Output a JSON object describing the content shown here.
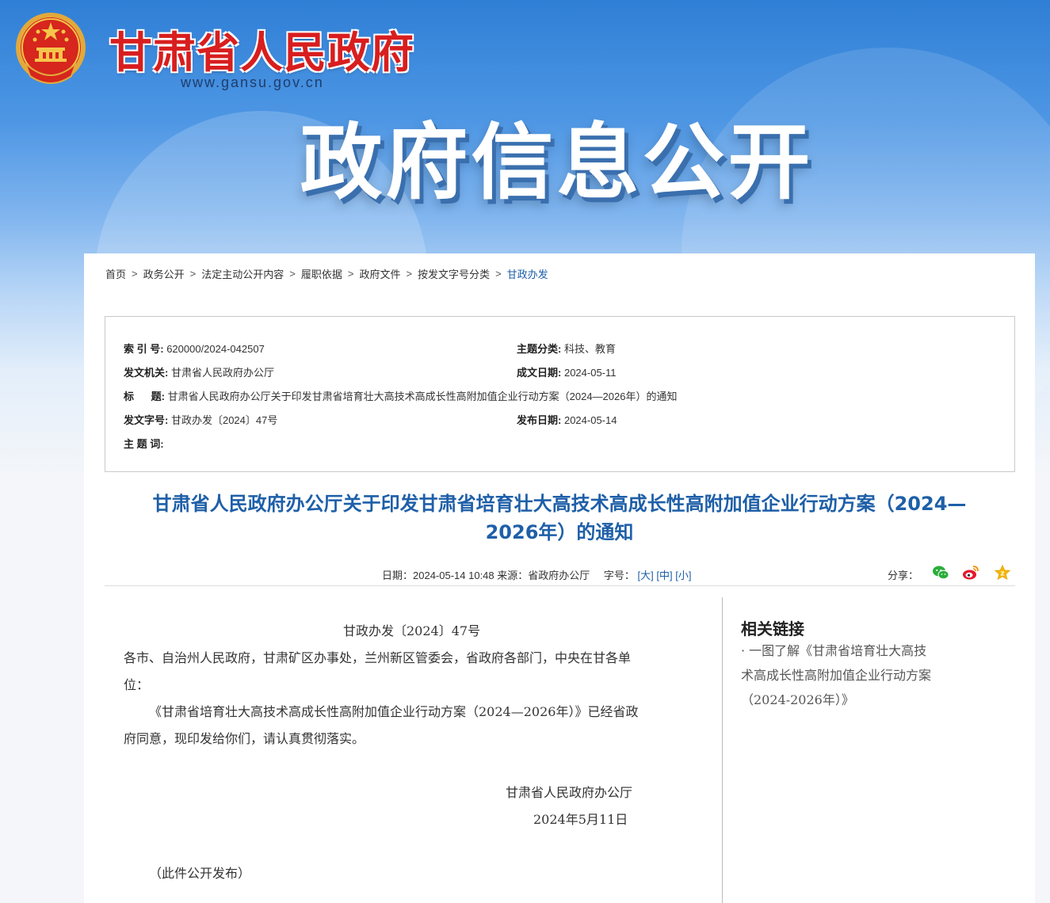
{
  "header": {
    "site_title": "甘肃省人民政府",
    "site_url": "www.gansu.gov.cn",
    "banner_heading": "政府信息公开"
  },
  "breadcrumb": [
    "首页",
    "政务公开",
    "法定主动公开内容",
    "履职依据",
    "政府文件",
    "按发文字号分类",
    "甘政办发"
  ],
  "breadcrumb_sep": ">",
  "meta": {
    "index_no_label": "索 引 号:",
    "index_no": "620000/2024-042507",
    "topic_label": "主题分类:",
    "topic": "科技、教育",
    "issuer_label": "发文机关:",
    "issuer": "甘肃省人民政府办公厅",
    "created_label": "成文日期:",
    "created": "2024-05-11",
    "title_label": "标      题:",
    "title": "甘肃省人民政府办公厅关于印发甘肃省培育壮大高技术高成长性高附加值企业行动方案（2024—2026年）的通知",
    "doc_no_label": "发文字号:",
    "doc_no": "甘政办发〔2024〕47号",
    "published_label": "发布日期:",
    "published": "2024-05-14",
    "keywords_label": "主 题 词:"
  },
  "doc_title_line1": "甘肃省人民政府办公厅关于印发甘肃省培育壮大高技术高成长性高附加值企业行动方案（2024—",
  "doc_title_line2": "2026年）的通知",
  "info_bar": {
    "date_text": "日期：2024-05-14 10:48 来源：省政府办公厅",
    "font_label": "字号：",
    "font_large": "[大]",
    "font_medium": "[中]",
    "font_small": "[小]",
    "share_label": "分享："
  },
  "body": {
    "doc_no": "甘政办发〔2024〕47号",
    "recipients_line1": "各市、自治州人民政府，甘肃矿区办事处，兰州新区管委会，省政府各部门，中央在甘各单",
    "recipients_line2": "位：",
    "para_line1": "《甘肃省培育壮大高技术高成长性高附加值企业行动方案（2024—2026年）》已经省政",
    "para_line2": "府同意，现印发给你们，请认真贯彻落实。",
    "signature": "甘肃省人民政府办公厅",
    "sign_date": "2024年5月11日",
    "public_note": "（此件公开发布）"
  },
  "related": {
    "title": "相关链接",
    "link_line1": "· 一图了解《甘肃省培育壮大高技",
    "link_line2": "术高成长性高附加值企业行动方案",
    "link_line3": "（2024-2026年）》"
  },
  "colors": {
    "title_red": "#d81e1e",
    "link_blue": "#1e5fa8",
    "wechat_green": "#2aae3b",
    "weibo_red": "#e6162d",
    "star_gold": "#f2b705"
  }
}
